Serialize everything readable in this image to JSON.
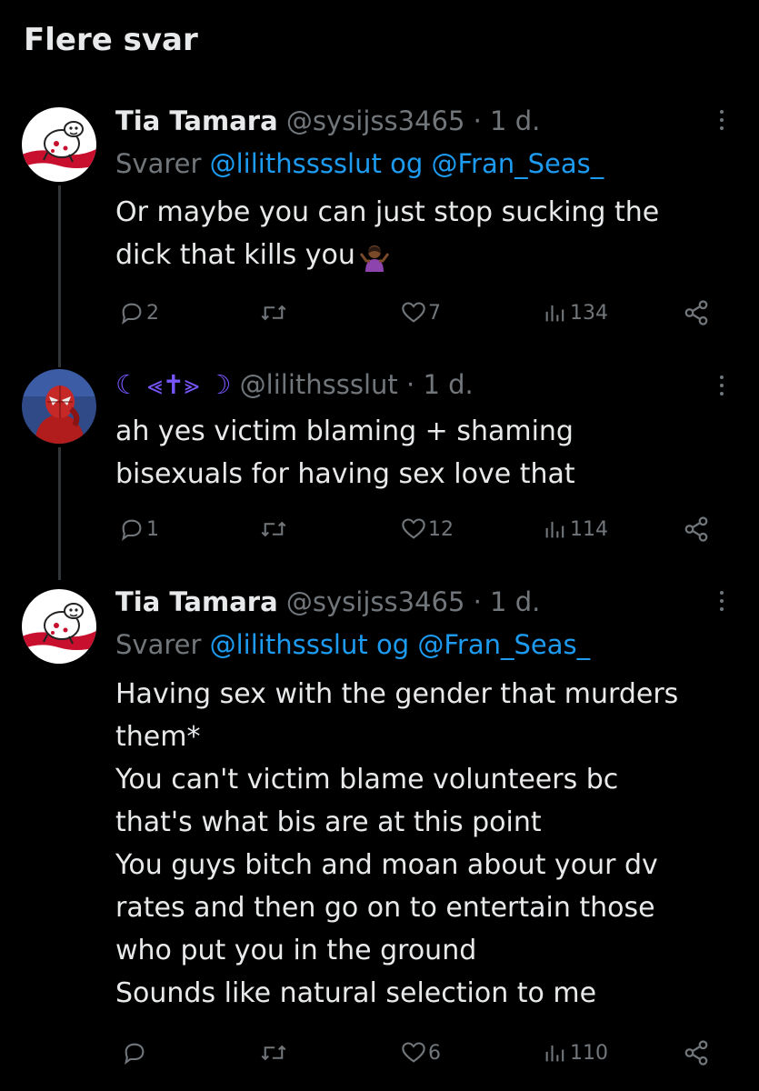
{
  "section_title": "Flere svar",
  "posts": [
    {
      "display_name": "Tia Tamara",
      "handle": "@sysijss3465",
      "time": "· 1 d.",
      "reply_prefix": "Svarer",
      "reply_mention1": "@lilithsssslut",
      "reply_og": "og",
      "reply_mention2": "@Fran_Seas_",
      "body_lines": [
        "Or maybe you can just stop sucking the",
        "dick that kills you"
      ],
      "emoji": "woman-shrugging-emoji",
      "replies": "2",
      "retweets": "",
      "likes": "7",
      "views": "134"
    },
    {
      "display_name": "☾ ⪡✝⪢ ☽",
      "handle": "@lilithssslut",
      "time": "· 1 d.",
      "body_lines": [
        "ah yes victim blaming + shaming",
        "bisexuals for having sex love that"
      ],
      "replies": "1",
      "retweets": "",
      "likes": "12",
      "views": "114"
    },
    {
      "display_name": "Tia Tamara",
      "handle": "@sysijss3465",
      "time": "· 1 d.",
      "reply_prefix": "Svarer",
      "reply_mention1": "@lilithssslut",
      "reply_og": "og",
      "reply_mention2": "@Fran_Seas_",
      "body_lines": [
        "Having sex with the gender that murders",
        "them*",
        "You can't victim blame volunteers bc",
        "that's what bis are at this point",
        "You guys bitch and moan about your dv",
        "rates and then go on to entertain those",
        "who put you in the ground",
        "Sounds like natural selection to me"
      ],
      "replies": "",
      "retweets": "",
      "likes": "6",
      "views": "110"
    }
  ],
  "colors": {
    "background": "#000000",
    "text": "#e7e9ea",
    "muted": "#71767b",
    "mention": "#1d9bf0",
    "name_purple": "#7856ff"
  }
}
